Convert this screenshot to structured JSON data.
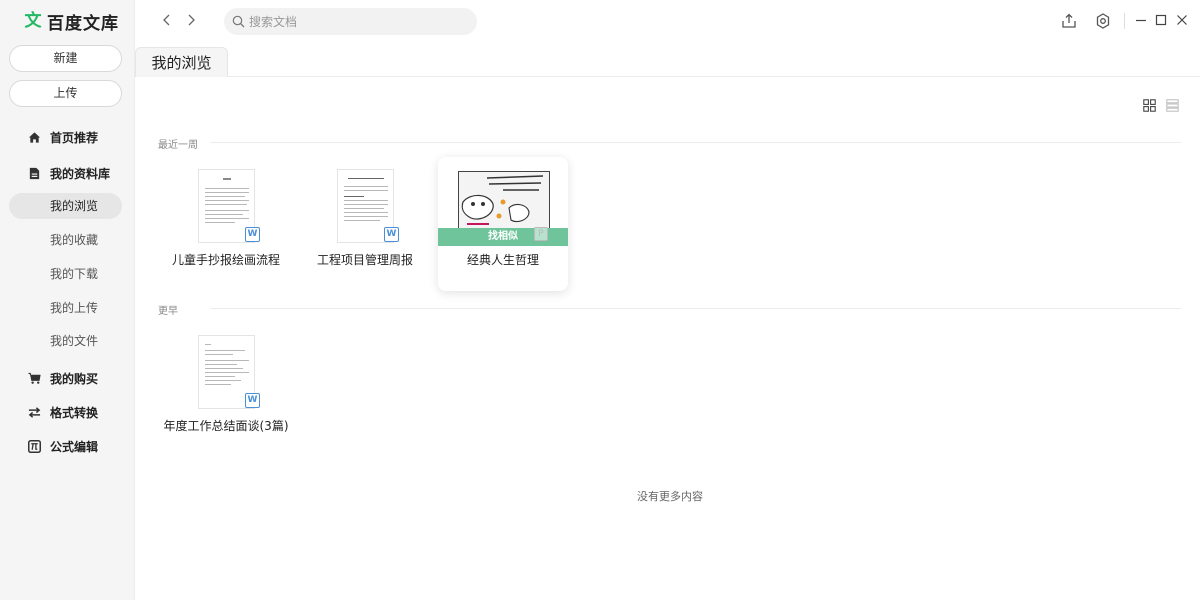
{
  "app": {
    "logo_glyph": "文",
    "name": "百度文库",
    "accent": "#25b864"
  },
  "sidebar": {
    "new_label": "新建",
    "upload_label": "上传",
    "home": "首页推荐",
    "library": "我的资料库",
    "sub_items": [
      "我的浏览",
      "我的收藏",
      "我的下载",
      "我的上传",
      "我的文件"
    ],
    "purchases": "我的购买",
    "convert": "格式转换",
    "formula": "公式编辑"
  },
  "search": {
    "placeholder": "搜索文档"
  },
  "tab": {
    "label": "我的浏览"
  },
  "sections": [
    {
      "label": "最近一周",
      "docs": [
        {
          "title": "儿童手抄报绘画流程",
          "badge": "W"
        },
        {
          "title": "工程项目管理周报",
          "badge": "W"
        },
        {
          "title": "经典人生哲理",
          "badge": "P",
          "overlay": "找相似"
        }
      ]
    },
    {
      "label": "更早",
      "docs": [
        {
          "title": "年度工作总结面谈(3篇)",
          "badge": "W"
        }
      ]
    }
  ],
  "footer": {
    "no_more": "没有更多内容"
  }
}
